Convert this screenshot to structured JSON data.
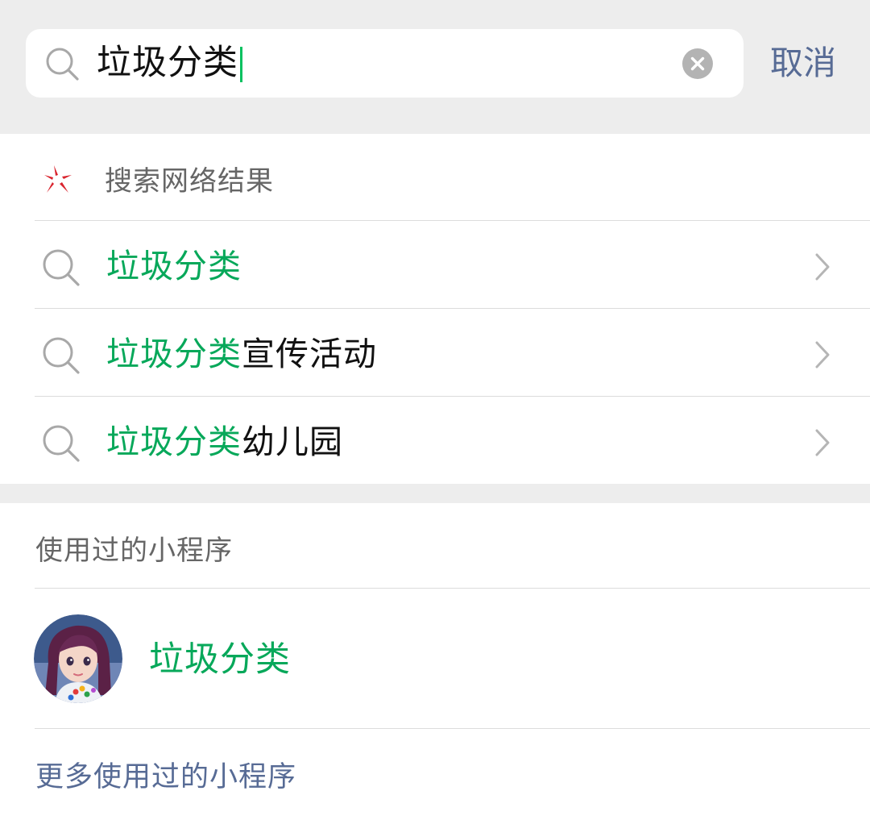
{
  "search": {
    "query": "垃圾分类",
    "cancel_label": "取消"
  },
  "web_results": {
    "header_label": "搜索网络结果",
    "suggestions": [
      {
        "match": "垃圾分类",
        "rest": ""
      },
      {
        "match": "垃圾分类",
        "rest": "宣传活动"
      },
      {
        "match": "垃圾分类",
        "rest": "幼儿园"
      }
    ]
  },
  "mini_programs": {
    "header_label": "使用过的小程序",
    "items": [
      {
        "name": "垃圾分类"
      }
    ],
    "more_label": "更多使用过的小程序"
  },
  "colors": {
    "accent_green": "#07a85a",
    "link_blue": "#576b95",
    "background_gray": "#ededed"
  }
}
